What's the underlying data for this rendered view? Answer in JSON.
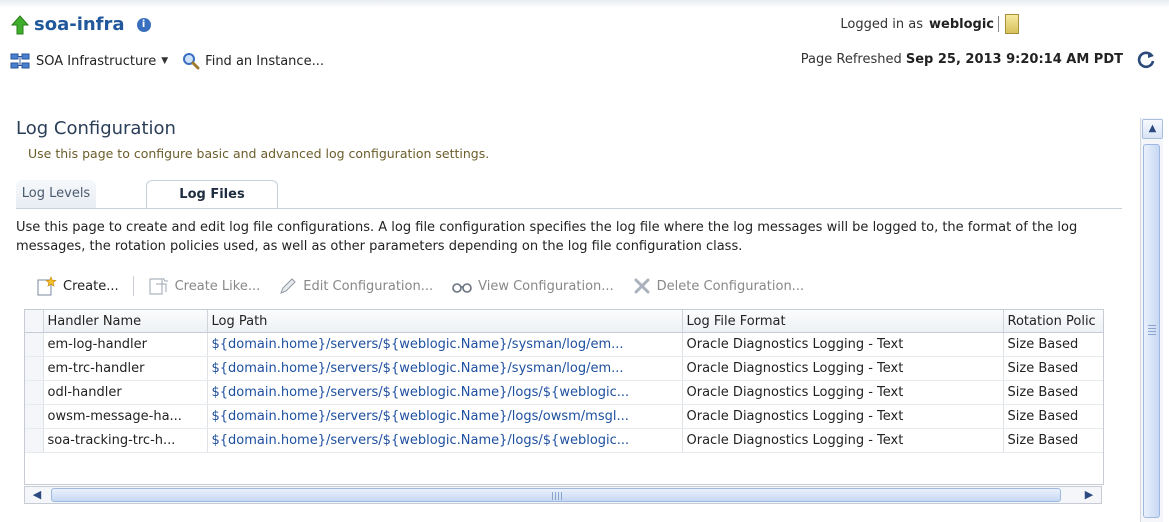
{
  "header": {
    "target_name": "soa-infra",
    "login_prefix": "Logged in as",
    "username": "weblogic",
    "menu_label": "SOA Infrastructure",
    "find_label": "Find an Instance...",
    "refreshed_prefix": "Page Refreshed",
    "refreshed_time": "Sep 25, 2013 9:20:14 AM PDT"
  },
  "page": {
    "title": "Log Configuration",
    "description": "Use this page to configure basic and advanced log configuration settings."
  },
  "tabs": [
    {
      "label": "Log Levels",
      "active": false
    },
    {
      "label": "Log Files",
      "active": true
    }
  ],
  "tab_description": "Use this page to create and edit log file configurations. A log file configuration specifies the log file where the log messages will be logged to, the format of the log messages, the rotation policies used, as well as other parameters depending on the log file configuration class.",
  "toolbar": {
    "create": "Create...",
    "create_like": "Create Like...",
    "edit": "Edit Configuration...",
    "view": "View Configuration...",
    "delete": "Delete Configuration..."
  },
  "table": {
    "columns": [
      "Handler Name",
      "Log Path",
      "Log File Format",
      "Rotation Polic"
    ],
    "rows": [
      {
        "handler": "em-log-handler",
        "path": "${domain.home}/servers/${weblogic.Name}/sysman/log/em...",
        "format": "Oracle Diagnostics Logging - Text",
        "rotation": "Size Based"
      },
      {
        "handler": "em-trc-handler",
        "path": "${domain.home}/servers/${weblogic.Name}/sysman/log/em...",
        "format": "Oracle Diagnostics Logging - Text",
        "rotation": "Size Based"
      },
      {
        "handler": "odl-handler",
        "path": "${domain.home}/servers/${weblogic.Name}/logs/${weblogic...",
        "format": "Oracle Diagnostics Logging - Text",
        "rotation": "Size Based"
      },
      {
        "handler": "owsm-message-ha...",
        "path": "${domain.home}/servers/${weblogic.Name}/logs/owsm/msgl...",
        "format": "Oracle Diagnostics Logging - Text",
        "rotation": "Size Based"
      },
      {
        "handler": "soa-tracking-trc-h...",
        "path": "${domain.home}/servers/${weblogic.Name}/logs/${weblogic...",
        "format": "Oracle Diagnostics Logging - Text",
        "rotation": "Size Based"
      }
    ]
  },
  "colors": {
    "link": "#1e4fa0",
    "title": "#2a3e58",
    "description": "#6b5d2a",
    "target": "#21589b"
  }
}
